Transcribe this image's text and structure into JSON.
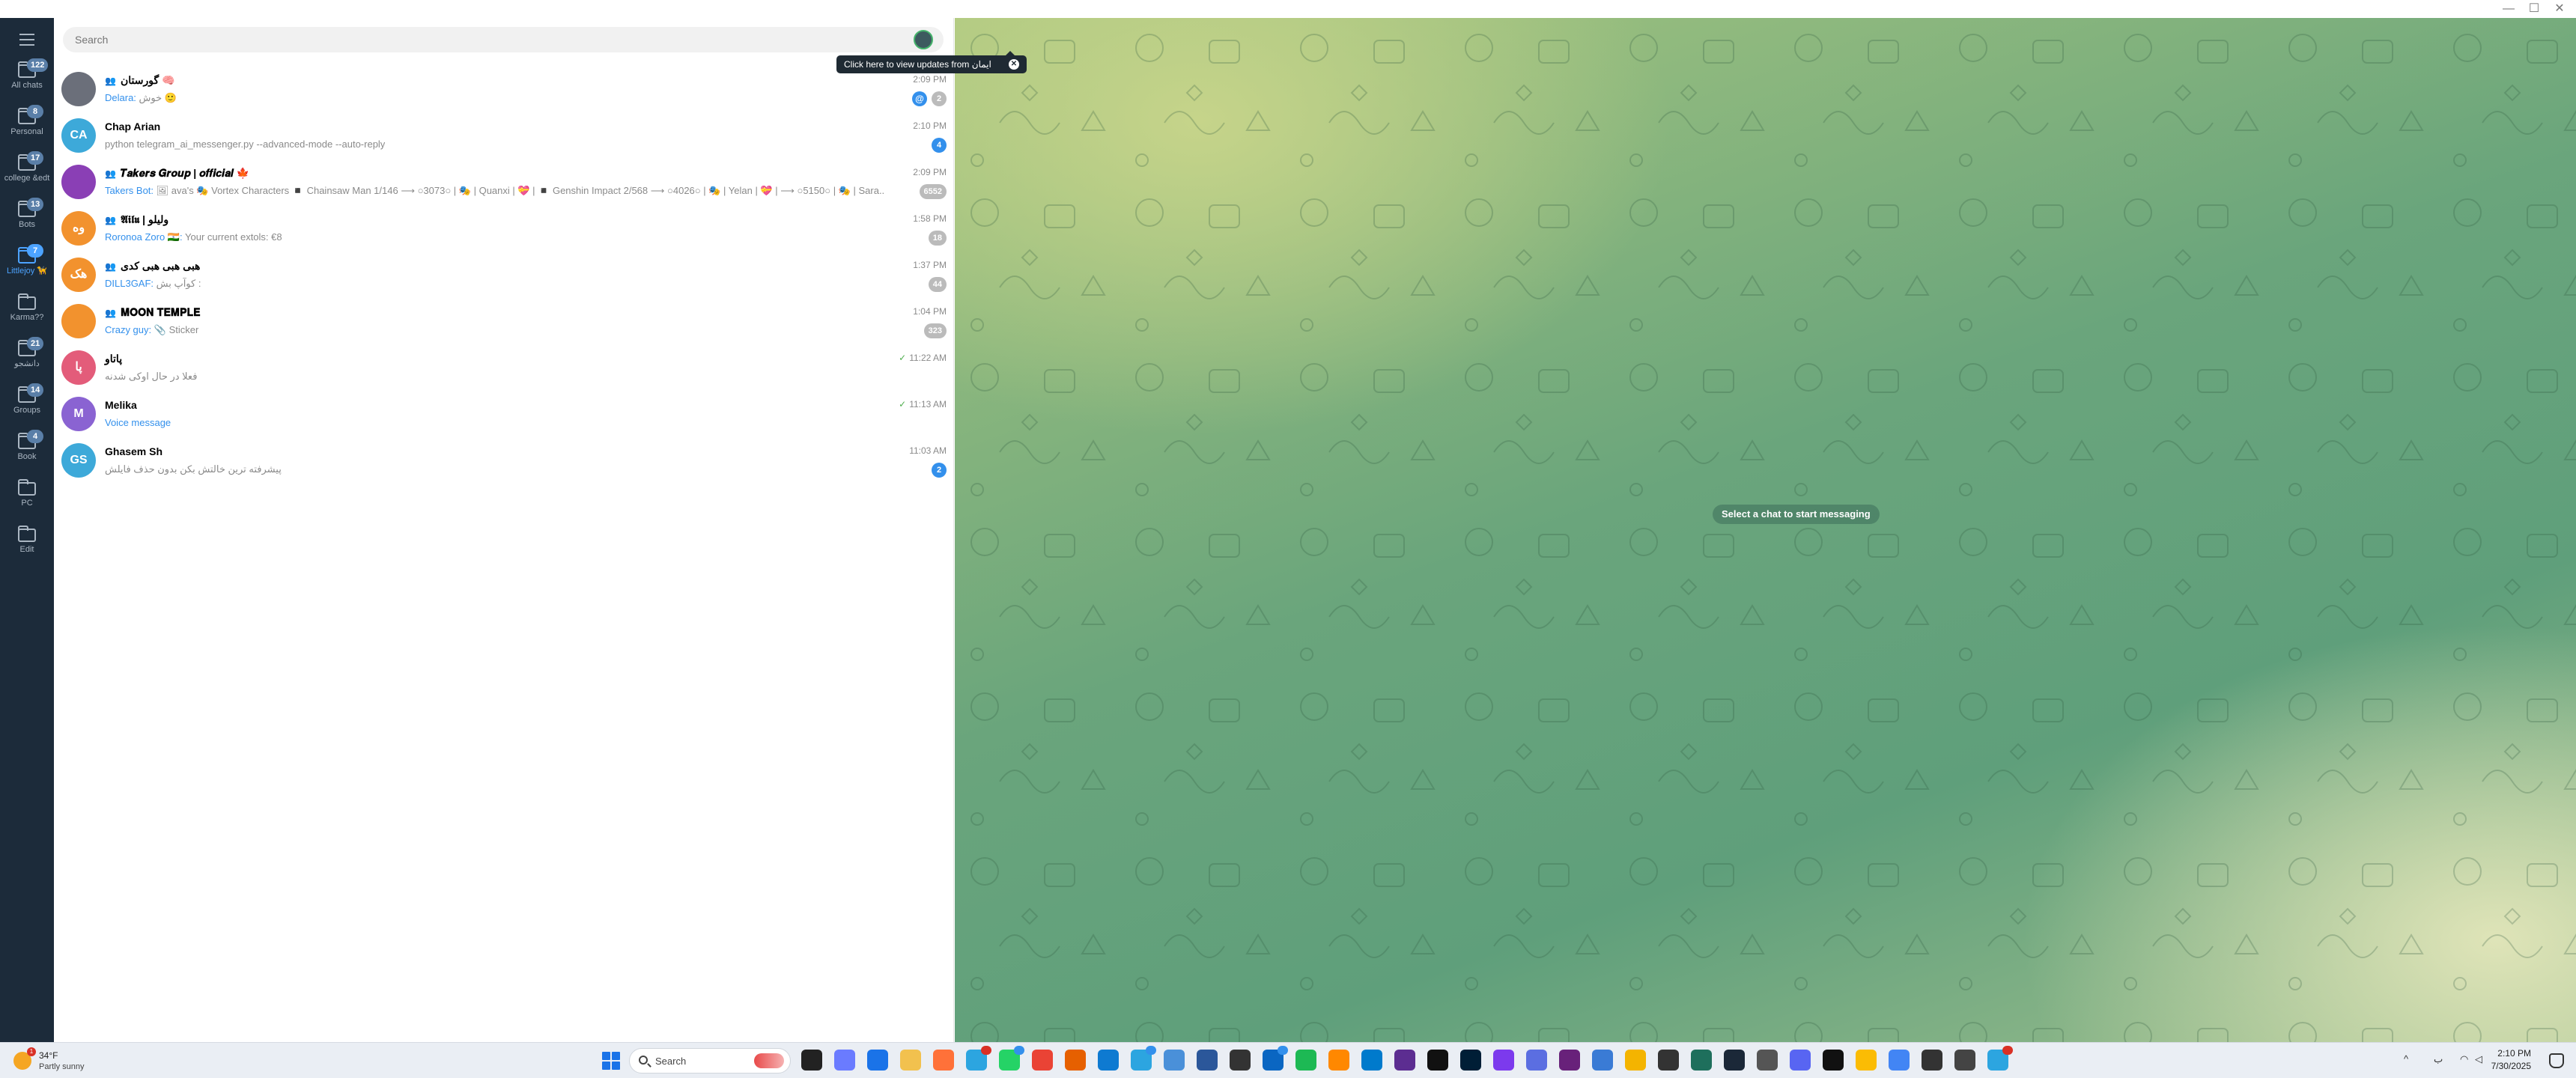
{
  "window": {
    "minimize": "—",
    "maximize": "☐",
    "close": "✕"
  },
  "sidebar": {
    "folders": [
      {
        "label": "All chats",
        "badge": "122",
        "active": false
      },
      {
        "label": "Personal",
        "badge": "8",
        "active": false
      },
      {
        "label": "college &edt",
        "badge": "17",
        "active": false
      },
      {
        "label": "Bots",
        "badge": "13",
        "active": false
      },
      {
        "label": "Littlejoy 🦮",
        "badge": "7",
        "active": true
      },
      {
        "label": "Karma??",
        "badge": "",
        "active": false
      },
      {
        "label": "دانشجو",
        "badge": "21",
        "active": false
      },
      {
        "label": "Groups",
        "badge": "14",
        "active": false
      },
      {
        "label": "Book",
        "badge": "4",
        "active": false
      },
      {
        "label": "PC",
        "badge": "",
        "active": false
      },
      {
        "label": "Edit",
        "badge": "",
        "active": false
      }
    ]
  },
  "search": {
    "placeholder": "Search"
  },
  "tooltip": {
    "text": "Click here to view updates from ایمان",
    "close": "✕"
  },
  "chats": [
    {
      "name": "گورستان 🧠",
      "is_group": true,
      "time": "2:09 PM",
      "sender": "Delara:",
      "preview": "خوش 🙂",
      "badge": "2",
      "badge_style": "muted",
      "mention": "@",
      "avatar_text": "",
      "avatar_color": "#6b6f7a"
    },
    {
      "name": "Chap Arian",
      "is_group": false,
      "time": "2:10 PM",
      "sender": "",
      "preview": "python telegram_ai_messenger.py --advanced-mode --auto-reply",
      "badge": "4",
      "badge_style": "blue",
      "mention": "",
      "avatar_text": "CA",
      "avatar_color": "#3da9d9"
    },
    {
      "name": "𝑻𝒂𝒌𝒆𝒓𝒔 𝑮𝒓𝒐𝒖𝒑 | 𝒐𝒇𝒇𝒊𝒄𝒊𝒂𝒍 🍁",
      "is_group": true,
      "time": "2:09 PM",
      "sender": "Takers Bot:",
      "preview": "🖼 ava's 🎭 Vortex Characters ◾ Chainsaw Man 1/146 ⟶ ○3073○ | 🎭 | Quanxi | 💝 | ◾ Genshin Impact 2/568 ⟶ ○4026○ | 🎭 | Yelan | 💝 | ⟶ ○5150○ | 🎭 | Sara...",
      "badge": "6552",
      "badge_style": "muted",
      "mention": "",
      "avatar_text": "",
      "avatar_color": "#8a3fb5"
    },
    {
      "name": "𝕬𝖎𝖑𝖚 | ولیلو",
      "is_group": true,
      "time": "1:58 PM",
      "sender": "Roronoa Zoro 🇮🇳:",
      "preview": "Your current extols: €8",
      "badge": "18",
      "badge_style": "muted",
      "mention": "",
      "avatar_text": "وه",
      "avatar_color": "#f2922e"
    },
    {
      "name": "هبی هبی هبی کدی",
      "is_group": true,
      "time": "1:37 PM",
      "sender": "DILL3GAF:",
      "preview": "کوآپ بش :",
      "badge": "44",
      "badge_style": "muted",
      "mention": "",
      "avatar_text": "هک",
      "avatar_color": "#f2922e"
    },
    {
      "name": "𝐌𝐎𝐎𝐍 𝐓𝐄𝐌𝐏𝐋𝐄",
      "is_group": true,
      "time": "1:04 PM",
      "sender": "Crazy guy:",
      "preview": "📎 Sticker",
      "badge": "323",
      "badge_style": "muted",
      "mention": "",
      "avatar_text": "",
      "avatar_color": "#f2922e"
    },
    {
      "name": "پاتاو",
      "is_group": false,
      "time": "11:22 AM",
      "sender": "",
      "preview": "فعلا در حال اوکی شدنه",
      "badge": "",
      "badge_style": "",
      "mention": "",
      "avatar_text": "پا",
      "avatar_color": "#e35c7a",
      "read": true
    },
    {
      "name": "Melika",
      "is_group": false,
      "time": "11:13 AM",
      "sender": "",
      "preview": "Voice message",
      "preview_link": true,
      "badge": "",
      "badge_style": "",
      "mention": "",
      "avatar_text": "M",
      "avatar_color": "#8a63d2",
      "read": true
    },
    {
      "name": "Ghasem Sh",
      "is_group": false,
      "time": "11:03 AM",
      "sender": "",
      "preview": "پیشرفته ترین خالتش بکن بدون حذف فایلش",
      "badge": "2",
      "badge_style": "blue",
      "mention": "",
      "avatar_text": "GS",
      "avatar_color": "#3da9d9"
    }
  ],
  "main": {
    "empty_message": "Select a chat to start messaging"
  },
  "taskbar": {
    "weather_temp": "34°F",
    "weather_desc": "Partly sunny",
    "weather_badge": "1",
    "search_label": "Search",
    "time": "2:10 PM",
    "date": "7/30/2025",
    "tray_lang": "ب",
    "tray_chevron": "^"
  }
}
